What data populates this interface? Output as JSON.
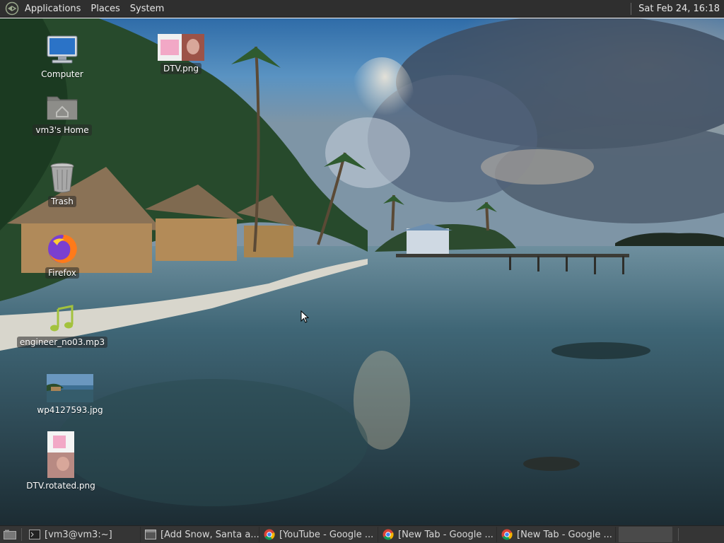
{
  "top_panel": {
    "menus": [
      "Applications",
      "Places",
      "System"
    ],
    "clock": "Sat Feb 24, 16:18",
    "logo_icon": "distro-logo-icon"
  },
  "desktop": {
    "icons": [
      {
        "label": "Computer",
        "icon": "computer-icon"
      },
      {
        "label": "vm3's Home",
        "icon": "home-folder-icon"
      },
      {
        "label": "Trash",
        "icon": "trash-icon"
      },
      {
        "label": "Firefox",
        "icon": "firefox-icon"
      },
      {
        "label": "engineer_no03.mp3",
        "icon": "music-note-icon"
      },
      {
        "label": "wp4127593.jpg",
        "icon": "image-thumbnail-icon"
      },
      {
        "label": "DTV.rotated.png",
        "icon": "image-thumbnail-icon"
      },
      {
        "label": "DTV.png",
        "icon": "image-thumbnail-icon"
      }
    ]
  },
  "taskbar": {
    "tasks": [
      {
        "label": "[vm3@vm3:~]",
        "icon": "terminal-icon"
      },
      {
        "label": "[Add Snow, Santa a...",
        "icon": "window-icon"
      },
      {
        "label": "[YouTube - Google ...",
        "icon": "chrome-icon"
      },
      {
        "label": "[New Tab - Google ...",
        "icon": "chrome-icon"
      },
      {
        "label": "[New Tab - Google ...",
        "icon": "chrome-icon"
      }
    ]
  },
  "colors": {
    "panel_bg": "#2f2f2f",
    "taskbar_bg": "#353535",
    "label_bg": "#333333"
  }
}
